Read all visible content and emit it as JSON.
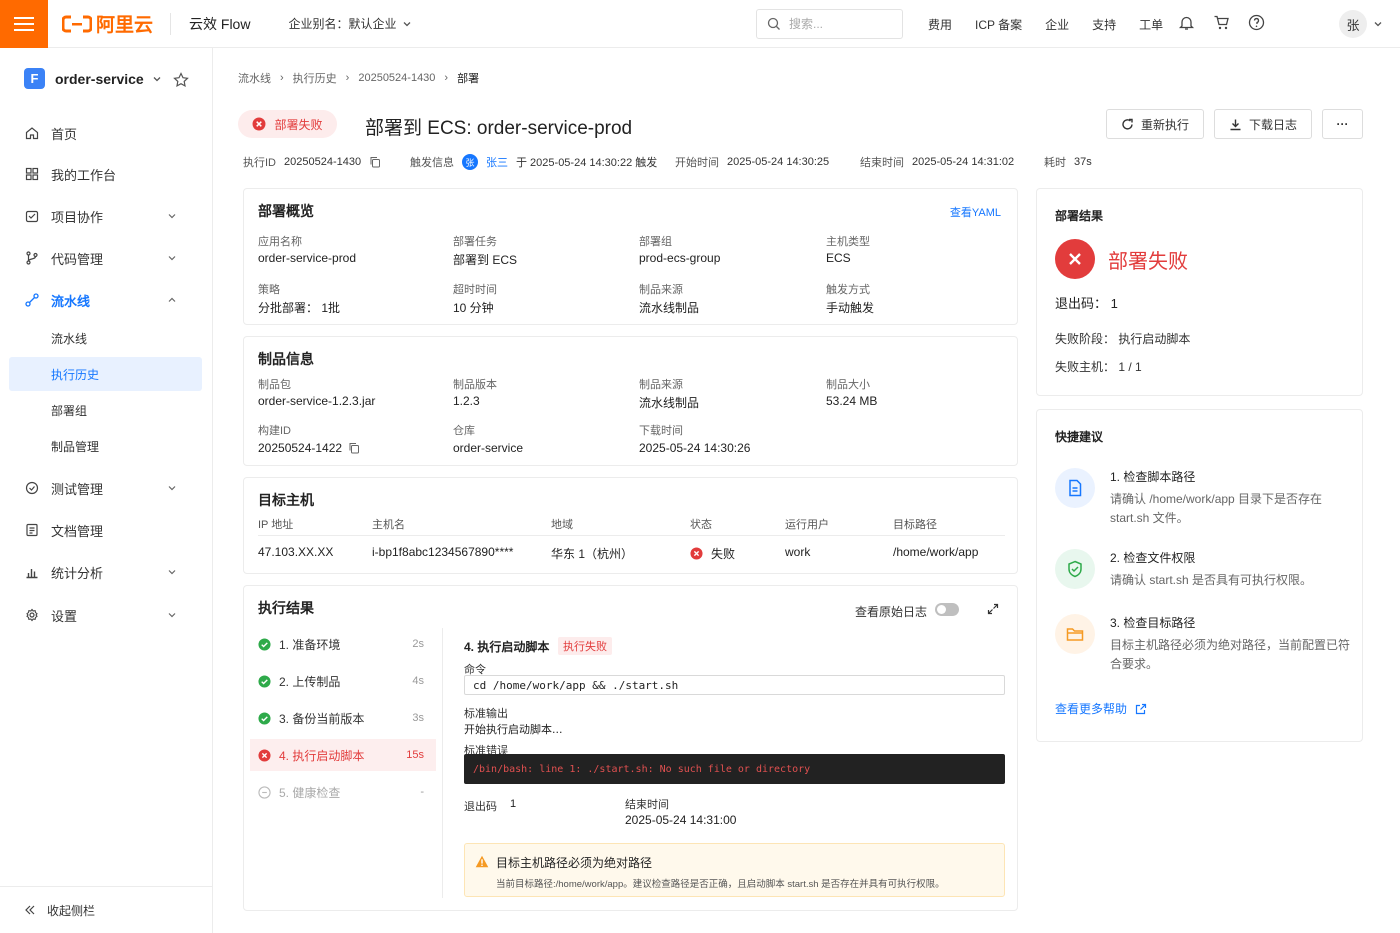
{
  "header": {
    "logo_text": "阿里云",
    "product": "云效 Flow",
    "alias_label": "企业别名：默认企业",
    "search_placeholder": "搜索...",
    "nav": [
      "费用",
      "ICP 备案",
      "企业",
      "支持",
      "工单"
    ],
    "avatar": "张"
  },
  "sidebar": {
    "project_badge": "F",
    "project_name": "order-service",
    "items": [
      "首页",
      "我的工作台",
      "项目协作",
      "代码管理",
      "流水线",
      "测试管理",
      "文档管理",
      "统计分析",
      "设置"
    ],
    "sub_items": [
      "流水线",
      "执行历史",
      "部署组",
      "制品管理"
    ],
    "collapse": "收起侧栏"
  },
  "breadcrumb": [
    "流水线",
    "执行历史",
    "20250524-1430",
    "部署"
  ],
  "status": "部署失败",
  "title": "部署到 ECS: order-service-prod",
  "actions": {
    "rerun": "重新执行",
    "download": "下载日志",
    "more": "···"
  },
  "meta": {
    "exec_id_label": "执行ID",
    "exec_id": "20250524-1430",
    "trigger_label": "触发信息",
    "trigger_avatar": "张",
    "trigger_user": "张三",
    "trigger_text": "于 2025-05-24 14:30:22 触发",
    "start_label": "开始时间",
    "start": "2025-05-24 14:30:25",
    "end_label": "结束时间",
    "end": "2025-05-24 14:31:02",
    "dur_label": "耗时",
    "dur": "37s"
  },
  "overview": {
    "title": "部署概览",
    "link": "查看YAML",
    "fields": [
      {
        "label": "应用名称",
        "value": "order-service-prod"
      },
      {
        "label": "部署任务",
        "value": "部署到 ECS"
      },
      {
        "label": "部署组",
        "value": "prod-ecs-group"
      },
      {
        "label": "主机类型",
        "value": "ECS"
      },
      {
        "label": "策略",
        "value": "分批部署： 1批"
      },
      {
        "label": "超时时间",
        "value": "10 分钟"
      },
      {
        "label": "制品来源",
        "value": "流水线制品"
      },
      {
        "label": "触发方式",
        "value": "手动触发"
      }
    ]
  },
  "artifact": {
    "title": "制品信息",
    "fields": [
      {
        "label": "制品包",
        "value": "order-service-1.2.3.jar"
      },
      {
        "label": "制品版本",
        "value": "1.2.3"
      },
      {
        "label": "制品来源",
        "value": "流水线制品"
      },
      {
        "label": "制品大小",
        "value": "53.24 MB"
      },
      {
        "label": "构建ID",
        "value": "20250524-1422"
      },
      {
        "label": "仓库",
        "value": "order-service"
      },
      {
        "label": "下载时间",
        "value": "2025-05-24 14:30:26"
      }
    ]
  },
  "hosts": {
    "title": "目标主机",
    "columns": [
      "IP 地址",
      "主机名",
      "地域",
      "状态",
      "运行用户",
      "目标路径"
    ],
    "row": [
      "47.103.XX.XX",
      "i-bp1f8abc1234567890****",
      "华东 1（杭州）",
      "失败",
      "work",
      "/home/work/app"
    ]
  },
  "exec": {
    "title": "执行结果",
    "raw_log": "查看原始日志",
    "steps": [
      {
        "label": "1. 准备环境",
        "dur": "2s"
      },
      {
        "label": "2. 上传制品",
        "dur": "4s"
      },
      {
        "label": "3. 备份当前版本",
        "dur": "3s"
      },
      {
        "label": "4. 执行启动脚本",
        "dur": "15s"
      },
      {
        "label": "5. 健康检查",
        "dur": "-"
      }
    ],
    "detail_title": "4. 执行启动脚本",
    "detail_badge": "执行失败",
    "cmd_label": "命令",
    "cmd": "cd /home/work/app && ./start.sh",
    "stdout_label": "标准输出",
    "stdout": "开始执行启动脚本...",
    "stderr_label": "标准错误",
    "stderr": "/bin/bash: line 1: ./start.sh: No such file or directory",
    "exit_label": "退出码",
    "exit": "1",
    "end_label": "结束时间",
    "end": "2025-05-24 14:31:00",
    "warn_title": "目标主机路径必须为绝对路径",
    "warn_text": "当前目标路径:/home/work/app。建议检查路径是否正确，且启动脚本 start.sh 是否存在并具有可执行权限。"
  },
  "result": {
    "title": "部署结果",
    "status": "部署失败",
    "exit": "退出码： 1",
    "stage": "失败阶段： 执行启动脚本",
    "hosts": "失败主机： 1 / 1"
  },
  "tips": {
    "title": "快捷建议",
    "items": [
      {
        "title": "1. 检查脚本路径",
        "desc": "请确认 /home/work/app 目录下是否存在 start.sh 文件。"
      },
      {
        "title": "2. 检查文件权限",
        "desc": "请确认 start.sh 是否具有可执行权限。"
      },
      {
        "title": "3. 检查目标路径",
        "desc": "目标主机路径必须为绝对路径，当前配置已符合要求。"
      }
    ],
    "more": "查看更多帮助"
  }
}
